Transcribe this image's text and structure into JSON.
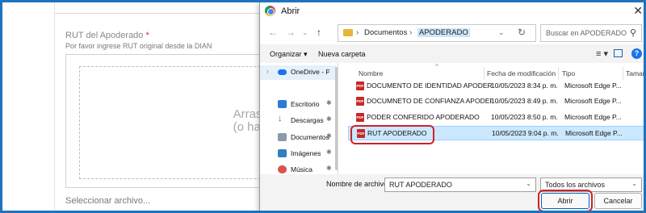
{
  "page": {
    "field_label": "RUT del Apoderado",
    "required_mark": "*",
    "field_help": "Por favor ingrese RUT original desde la DIAN",
    "drop_text_line1": "Arrastre y s",
    "drop_text_line2": "(o haga clic",
    "select_file_label": "Seleccionar archivo..."
  },
  "dialog": {
    "title": "Abrir",
    "close_glyph": "✕",
    "address": {
      "crumbs": [
        "Documentos",
        "APODERADO"
      ],
      "search_placeholder": "Buscar en APODERADO"
    },
    "toolbar": {
      "organize_label": "Organizar ▾",
      "new_folder_label": "Nueva carpeta",
      "help_glyph": "?"
    },
    "nav_pane": [
      {
        "label": "OneDrive - Perso",
        "icon": "cloud-icon"
      },
      {
        "label": "Escritorio",
        "icon": "desktop-icon"
      },
      {
        "label": "Descargas",
        "icon": "download-icon"
      },
      {
        "label": "Documentos",
        "icon": "documents-icon"
      },
      {
        "label": "Imágenes",
        "icon": "pictures-icon"
      },
      {
        "label": "Música",
        "icon": "music-icon"
      }
    ],
    "columns": [
      "Nombre",
      "Fecha de modificación",
      "Tipo",
      "Tamaño"
    ],
    "files": [
      {
        "name": "DOCUMENTO DE IDENTIDAD APODERADO",
        "date": "10/05/2023 8:34 p. m.",
        "type": "Microsoft Edge P..."
      },
      {
        "name": "DOCUMNETO DE CONFIANZA APODERA...",
        "date": "10/05/2023 8:49 p. m.",
        "type": "Microsoft Edge P..."
      },
      {
        "name": "PODER CONFERIDO APODERADO",
        "date": "10/05/2023 8:50 p. m.",
        "type": "Microsoft Edge P..."
      },
      {
        "name": "RUT APODERADO",
        "date": "10/05/2023 9:04 p. m.",
        "type": "Microsoft Edge P...",
        "selected": true
      }
    ],
    "filename_label": "Nombre de archivo:",
    "filename_value": "RUT APODERADO",
    "filter_value": "Todos los archivos",
    "open_label": "Abrir",
    "cancel_label": "Cancelar"
  },
  "colors": {
    "frame": "#1e73be",
    "highlight": "#d0202a",
    "selection": "#cce8ff",
    "pdf_icon": "#c62828"
  }
}
